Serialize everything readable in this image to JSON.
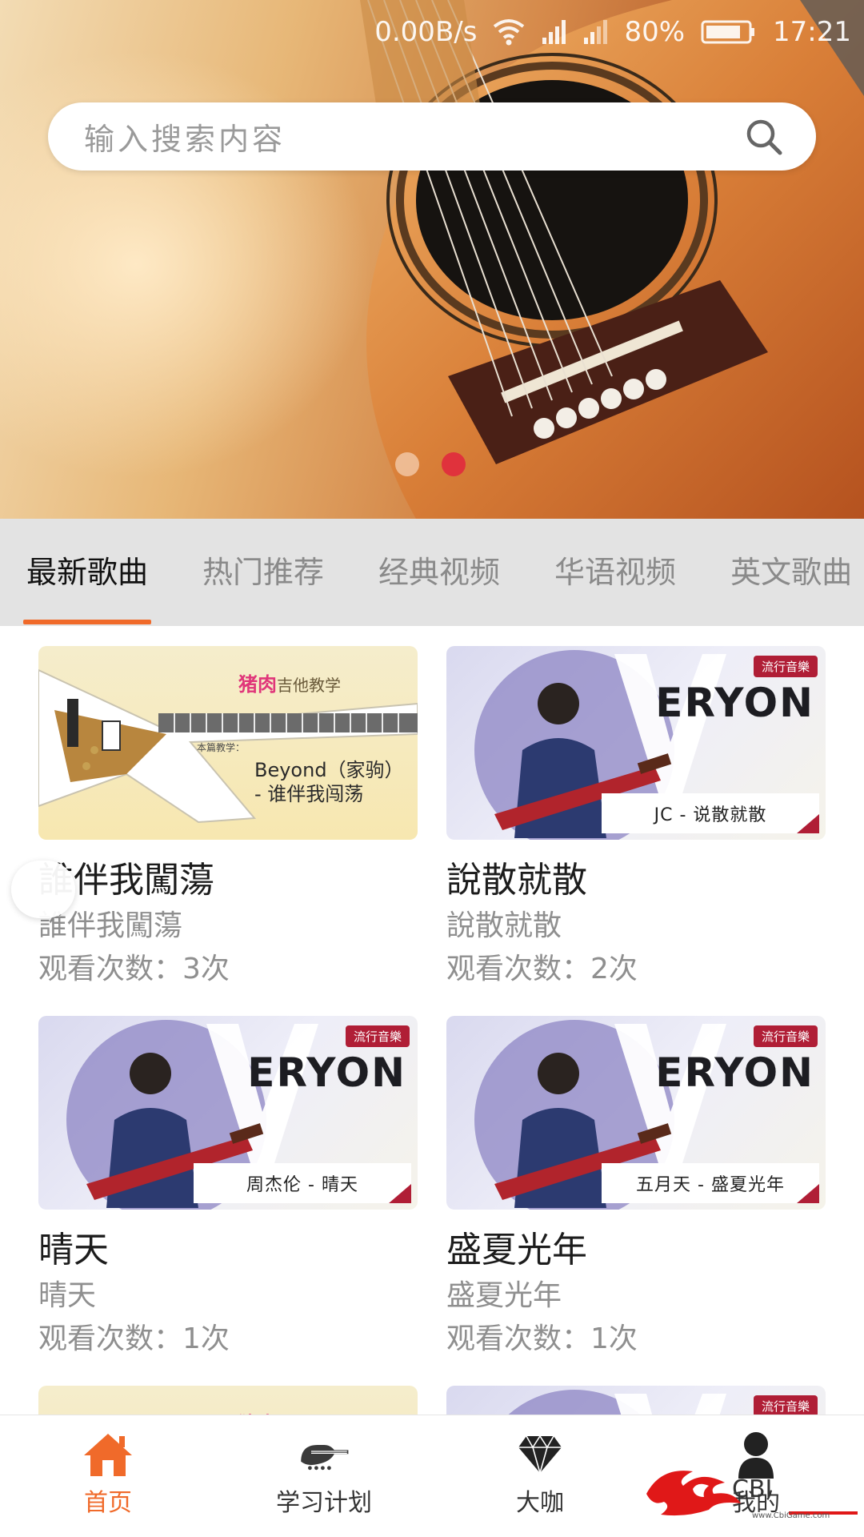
{
  "status_bar": {
    "speed": "0.00B/s",
    "battery": "80%",
    "time": "17:21"
  },
  "search": {
    "placeholder": "输入搜索内容"
  },
  "tabs": [
    {
      "label": "最新歌曲",
      "active": true
    },
    {
      "label": "热门推荐",
      "active": false
    },
    {
      "label": "经典视频",
      "active": false
    },
    {
      "label": "华语视频",
      "active": false
    },
    {
      "label": "英文歌曲",
      "active": false
    }
  ],
  "cards": [
    {
      "title": "誰伴我闖蕩",
      "subtitle": "誰伴我闖蕩",
      "views": "观看次数：3次",
      "thumb": {
        "brand_highlight": "猪肉",
        "brand_rest": "吉他教学",
        "lesson_tag": "本篇教学：",
        "lesson_line1": "Beyond（家驹）",
        "lesson_line2": "- 谁伴我闯荡"
      }
    },
    {
      "title": "說散就散",
      "subtitle": "說散就散",
      "views": "观看次数：2次",
      "thumb": {
        "badge": "流行音樂",
        "letters": "ERYON",
        "caption": "JC - 说散就散"
      }
    },
    {
      "title": "晴天",
      "subtitle": "晴天",
      "views": "观看次数：1次",
      "thumb": {
        "badge": "流行音樂",
        "letters": "ERYON",
        "caption": "周杰伦 - 晴天"
      }
    },
    {
      "title": "盛夏光年",
      "subtitle": "盛夏光年",
      "views": "观看次数：1次",
      "thumb": {
        "badge": "流行音樂",
        "letters": "ERYON",
        "caption": "五月天 - 盛夏光年"
      }
    },
    {
      "thumb": {
        "brand_highlight": "猪肉"
      }
    },
    {
      "thumb": {
        "badge": "流行音樂"
      }
    }
  ],
  "bottom_nav": [
    {
      "label": "首页",
      "icon": "home-icon",
      "active": true
    },
    {
      "label": "学习计划",
      "icon": "guitar-icon",
      "active": false
    },
    {
      "label": "大咖",
      "icon": "diamond-icon",
      "active": false
    },
    {
      "label": "我的",
      "icon": "person-icon",
      "active": false
    }
  ],
  "watermark": {
    "text": "CBI",
    "url": "www.CbiGame.com"
  },
  "colors": {
    "accent": "#f06a2a",
    "badge": "#b01e36",
    "dot_active": "#e0323c"
  }
}
